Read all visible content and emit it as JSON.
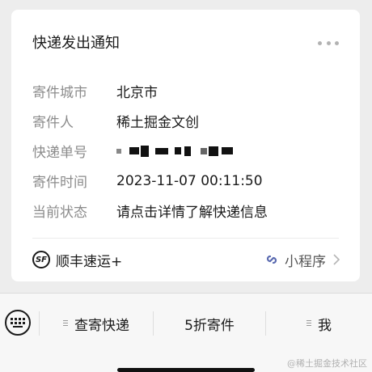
{
  "card": {
    "title": "快递发出通知",
    "rows": [
      {
        "label": "寄件城市",
        "value": "北京市"
      },
      {
        "label": "寄件人",
        "value": "稀土掘金文创"
      },
      {
        "label": "快递单号",
        "value": ""
      },
      {
        "label": "寄件时间",
        "value": "2023-11-07 00:11:50"
      },
      {
        "label": "当前状态",
        "value": "请点击详情了解快递信息"
      }
    ],
    "footer": {
      "brand_icon": "SF",
      "brand_label": "顺丰速运+",
      "mini_program_label": "小程序"
    }
  },
  "bottom_menu": {
    "items": [
      {
        "label": "查寄快递"
      },
      {
        "label": "5折寄件"
      },
      {
        "label": "我"
      }
    ]
  },
  "watermark": "@稀土掘金技术社区"
}
